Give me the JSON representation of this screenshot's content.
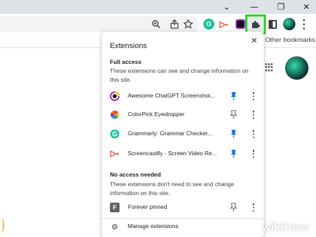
{
  "window": {
    "chevron_icon": "chevron-down-icon",
    "minimize_icon": "minimize-icon",
    "restore_icon": "restore-icon",
    "close_icon": "close-icon"
  },
  "toolbar": {
    "icons": [
      "zoom-icon",
      "share-icon",
      "star-icon",
      "grammarly-icon",
      "screencastify-icon",
      "chatgpt-screenshot-icon",
      "extensions-puzzle-icon",
      "side-panel-icon",
      "profile-avatar",
      "menu-icon"
    ],
    "grammarly_badge": "G",
    "highlight_color": "#2bd617"
  },
  "bookmarks_bar": {
    "other_bookmarks": "Other bookmarks"
  },
  "panel": {
    "title": "Extensions",
    "full_access": {
      "heading": "Full access",
      "description": "These extensions can see and change information on this site."
    },
    "full_access_items": [
      {
        "name": "Awesome ChatGPT Screenshot...",
        "pinned": true,
        "icon": "awesome-chatgpt-icon"
      },
      {
        "name": "ColorPick Eyedropper",
        "pinned": false,
        "icon": "colorpick-icon"
      },
      {
        "name": "Grammarly: Grammar Checker...",
        "pinned": true,
        "icon": "grammarly-icon"
      },
      {
        "name": "Screencastify - Screen Video Re...",
        "pinned": true,
        "icon": "screencastify-icon"
      }
    ],
    "no_access": {
      "heading": "No access needed",
      "description": "These extensions don't need to see and change information on this site."
    },
    "no_access_items": [
      {
        "name": "Forever pinned",
        "pinned": false,
        "icon": "forever-pinned-icon",
        "badge": "F"
      }
    ],
    "manage_label": "Manage extensions"
  },
  "colors": {
    "pinned": "#1a73e8",
    "unpinned": "#5f6368",
    "titlebar": "#dee1e6"
  },
  "watermark": {
    "brand_wiki": "wiki",
    "brand_how": "How"
  }
}
